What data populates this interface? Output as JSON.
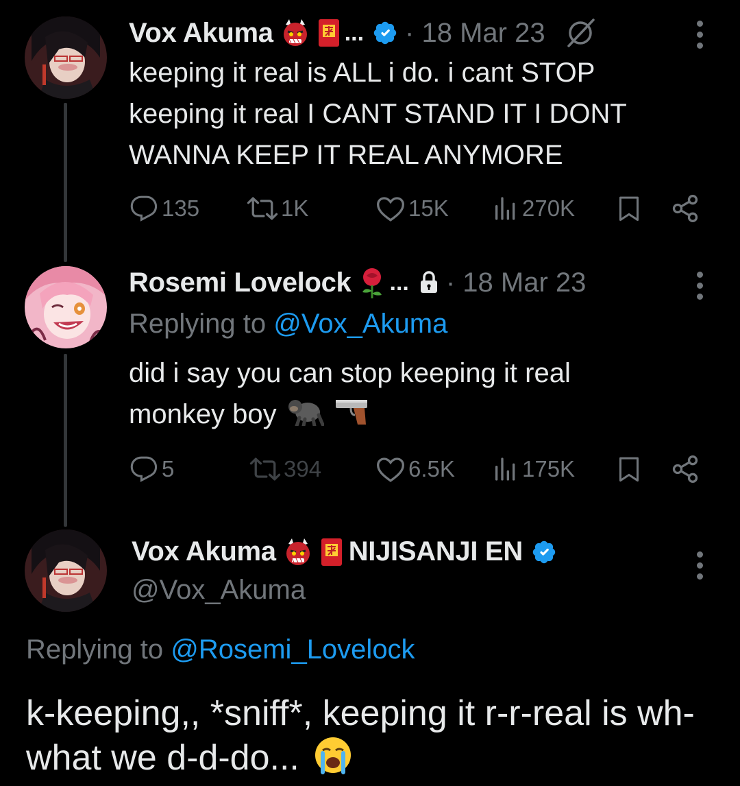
{
  "tweets": [
    {
      "display_name": "Vox Akuma",
      "emojis": [
        "ogre-emoji",
        "red-envelope-emoji"
      ],
      "truncation": "...",
      "date": "· 18 Mar 23",
      "text": "keeping it real is ALL i do. i cant STOP keeping it real I CANT STAND IT I DONT WANNA KEEP IT REAL ANYMORE",
      "actions": {
        "replies": "135",
        "retweets": "1K",
        "likes": "15K",
        "views": "270K"
      }
    },
    {
      "display_name": "Rosemi Lovelock",
      "emojis": [
        "rose-emoji"
      ],
      "truncation": "...",
      "date": "· 18 Mar 23",
      "replying_prefix": "Replying to",
      "replying_handle": "@Vox_Akuma",
      "text": "did i say you can stop keeping it real monkey boy",
      "actions": {
        "replies": "5",
        "retweets": "394",
        "likes": "6.5K",
        "views": "175K"
      }
    }
  ],
  "main_tweet": {
    "display_name": "Vox Akuma",
    "emojis": [
      "ogre-emoji",
      "red-envelope-emoji"
    ],
    "affiliation": "NIJISANJI EN",
    "handle": "@Vox_Akuma",
    "replying_prefix": "Replying to",
    "replying_handle": "@Rosemi_Lovelock",
    "text": "k-keeping,, *sniff*, keeping it r-r-real is wh-what we d-d-do..."
  },
  "icons": [
    "reply-icon",
    "retweet-icon",
    "like-icon",
    "views-icon",
    "bookmark-icon",
    "share-icon",
    "verified-badge-icon",
    "lock-icon",
    "grok-slash-icon",
    "more-icon"
  ],
  "colors": {
    "background": "#000000",
    "text": "#e7e9ea",
    "muted": "#71767b",
    "accent": "#1d9bf0",
    "thread_line": "#333639"
  }
}
